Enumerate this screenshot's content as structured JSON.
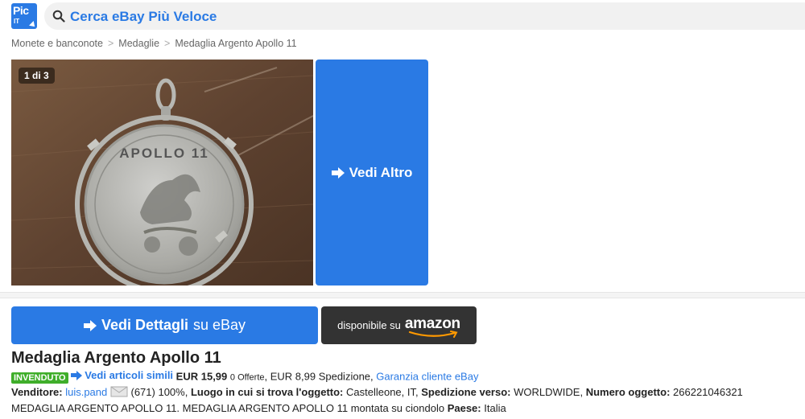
{
  "header": {
    "logo_text": "Pic",
    "logo_sub": "IT",
    "search_text": "Cerca eBay Più Veloce"
  },
  "breadcrumb": [
    "Monete e banconote",
    "Medaglie",
    "Medaglia Argento Apollo 11"
  ],
  "gallery": {
    "counter": "1 di 3",
    "medal_text": "APOLLO 11",
    "more_label": "Vedi Altro"
  },
  "actions": {
    "ebay_bold": "Vedi Dettagli",
    "ebay_rest": "su eBay",
    "amazon_prefix": "disponibile su",
    "amazon_logo": "amazon"
  },
  "listing": {
    "title": "Medaglia Argento Apollo 11",
    "status_badge": "INVENDUTO",
    "similar_link": "Vedi articoli simili",
    "price": "EUR 15,99",
    "offers": "0 Offerte",
    "shipping": ", EUR 8,99 Spedizione,",
    "guarantee_link": "Garanzia cliente eBay",
    "seller_label": "Venditore:",
    "seller_name": "luis.pand",
    "seller_feedback": "(671) 100%,",
    "location_label": "Luogo in cui si trova l'oggetto:",
    "location": "Castelleone, IT,",
    "ship_to_label": "Spedizione verso:",
    "ship_to": "WORLDWIDE,",
    "item_no_label": "Numero oggetto:",
    "item_no": "266221046321",
    "description": "MEDAGLIA ARGENTO APOLLO 11. MEDAGLIA ARGENTO APOLLO 11 montata su ciondolo",
    "country_label": "Paese:",
    "country": "Italia"
  },
  "colors": {
    "accent": "#2a7ae4",
    "badge": "#3fae2a",
    "amazon_bg": "#333333",
    "amazon_smile": "#ff9900"
  },
  "icons": [
    "search-icon",
    "arrow-right-icon",
    "envelope-icon",
    "amazon-smile-icon"
  ]
}
